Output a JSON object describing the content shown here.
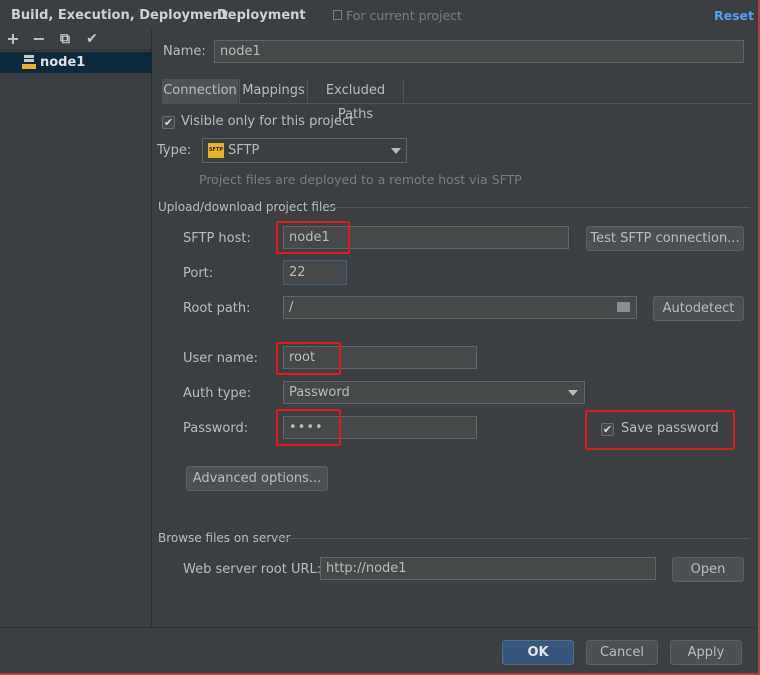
{
  "header": {
    "breadcrumb_parent": "Build, Execution, Deployment",
    "breadcrumb_sep": "›",
    "breadcrumb_current": "Deployment",
    "scope_hint": "For current project",
    "reset_label": "Reset"
  },
  "toolbar": {
    "add": "+",
    "remove": "−",
    "copy": "⧉",
    "apply": "✔"
  },
  "sidebar": {
    "items": [
      {
        "label": "node1",
        "icon": "sftp-server-icon",
        "selected": true
      }
    ]
  },
  "form": {
    "name_label": "Name:",
    "name_value": "node1",
    "tabs": [
      {
        "label": "Connection",
        "active": true
      },
      {
        "label": "Mappings",
        "active": false
      },
      {
        "label": "Excluded Paths",
        "active": false
      }
    ],
    "visible_only_label": "Visible only for this project",
    "visible_only_checked": true,
    "type_label": "Type:",
    "type_value": "SFTP",
    "type_icon_text": "SFTP",
    "type_hint": "Project files are deployed to a remote host via SFTP",
    "upload_section": "Upload/download project files",
    "host_label": "SFTP host:",
    "host_value": "node1",
    "test_button": "Test SFTP connection...",
    "port_label": "Port:",
    "port_value": "22",
    "root_path_label": "Root path:",
    "root_path_value": "/",
    "autodetect_button": "Autodetect",
    "user_label": "User name:",
    "user_value": "root",
    "auth_label": "Auth type:",
    "auth_value": "Password",
    "password_label": "Password:",
    "password_value": "••••",
    "save_password_label": "Save password",
    "save_password_checked": true,
    "advanced_button": "Advanced options...",
    "browse_section": "Browse files on server",
    "web_root_label": "Web server root URL:",
    "web_root_value": "http://node1",
    "open_button": "Open"
  },
  "footer": {
    "ok": "OK",
    "cancel": "Cancel",
    "apply": "Apply"
  },
  "colors": {
    "background": "#3c3f41",
    "selection": "#0d293e",
    "primary": "#365880",
    "highlight": "#e01b1b"
  }
}
